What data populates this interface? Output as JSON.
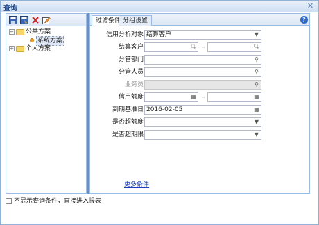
{
  "window": {
    "title": "查询"
  },
  "toolbar": {
    "buttons": [
      "save-icon",
      "save-as-icon",
      "delete-icon",
      "edit-icon"
    ]
  },
  "tree": {
    "public": "公共方案",
    "system": "系统方案",
    "personal": "个人方案"
  },
  "tabs": [
    "过滤条件",
    "分组设置"
  ],
  "form": {
    "credit_object_label": "信用分析对象",
    "credit_object_value": "结算客户",
    "settle_customer_label": "结算客户",
    "dept_label": "分管部门",
    "person_label": "分管人员",
    "salesman_label": "业务员",
    "credit_amount_label": "信用额度",
    "expiry_label": "到期基准日",
    "expiry_value": "2016-02-05",
    "over_amount_label": "是否超额度",
    "over_period_label": "是否超期限",
    "dash": "–"
  },
  "more_link": "更多条件",
  "bottom_checkbox": "不显示查询条件，直接进入报表"
}
